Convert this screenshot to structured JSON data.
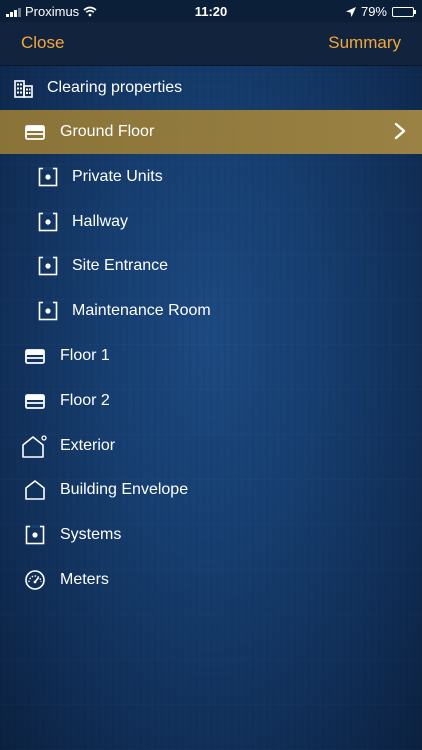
{
  "status": {
    "carrier": "Proximus",
    "time": "11:20",
    "battery_percent": "79%",
    "battery_level": 0.79
  },
  "nav": {
    "close_label": "Close",
    "summary_label": "Summary"
  },
  "header": {
    "title": "Clearing properties"
  },
  "items": [
    {
      "label": "Ground Floor",
      "icon": "floor-icon",
      "level": 0,
      "selected": true
    },
    {
      "label": "Private Units",
      "icon": "unit-icon",
      "level": 1,
      "selected": false
    },
    {
      "label": "Hallway",
      "icon": "unit-icon",
      "level": 1,
      "selected": false
    },
    {
      "label": "Site Entrance",
      "icon": "unit-icon",
      "level": 1,
      "selected": false
    },
    {
      "label": "Maintenance Room",
      "icon": "unit-icon",
      "level": 1,
      "selected": false
    },
    {
      "label": "Floor 1",
      "icon": "floor-icon",
      "level": 0,
      "selected": false
    },
    {
      "label": "Floor 2",
      "icon": "floor-icon",
      "level": 0,
      "selected": false
    },
    {
      "label": "Exterior",
      "icon": "exterior-icon",
      "level": 0,
      "selected": false
    },
    {
      "label": "Building Envelope",
      "icon": "house-icon",
      "level": 0,
      "selected": false
    },
    {
      "label": "Systems",
      "icon": "unit-icon",
      "level": 0,
      "selected": false
    },
    {
      "label": "Meters",
      "icon": "meter-icon",
      "level": 0,
      "selected": false
    }
  ],
  "colors": {
    "accent": "#f2a83a",
    "selected_row": "#8a7338",
    "background": "#163d6e"
  }
}
